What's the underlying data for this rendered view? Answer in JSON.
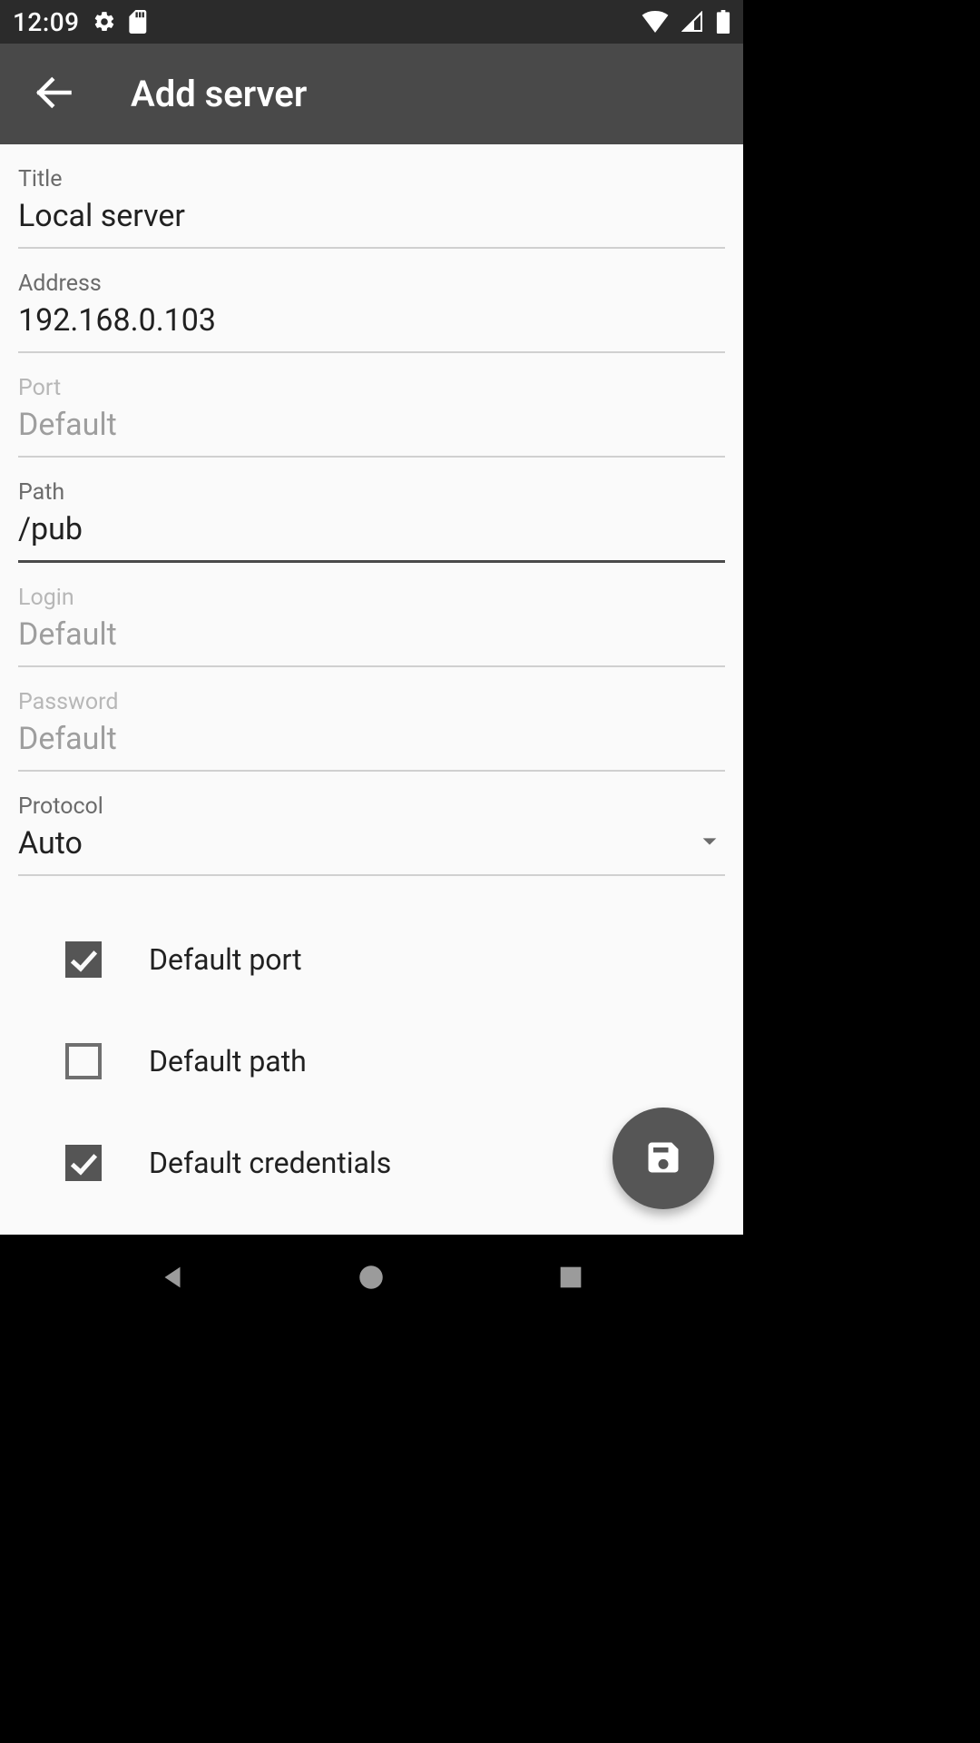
{
  "status": {
    "time": "12:09"
  },
  "header": {
    "title": "Add server"
  },
  "fields": {
    "title": {
      "label": "Title",
      "value": "Local server",
      "placeholder": ""
    },
    "address": {
      "label": "Address",
      "value": "192.168.0.103",
      "placeholder": ""
    },
    "port": {
      "label": "Port",
      "value": "",
      "placeholder": "Default"
    },
    "path": {
      "label": "Path",
      "value": "/pub",
      "placeholder": ""
    },
    "login": {
      "label": "Login",
      "value": "",
      "placeholder": "Default"
    },
    "password": {
      "label": "Password",
      "value": "",
      "placeholder": "Default"
    },
    "protocol": {
      "label": "Protocol",
      "value": "Auto"
    }
  },
  "checks": {
    "default_port": {
      "label": "Default port",
      "checked": true
    },
    "default_path": {
      "label": "Default path",
      "checked": false
    },
    "default_credentials": {
      "label": "Default credentials",
      "checked": true
    }
  }
}
